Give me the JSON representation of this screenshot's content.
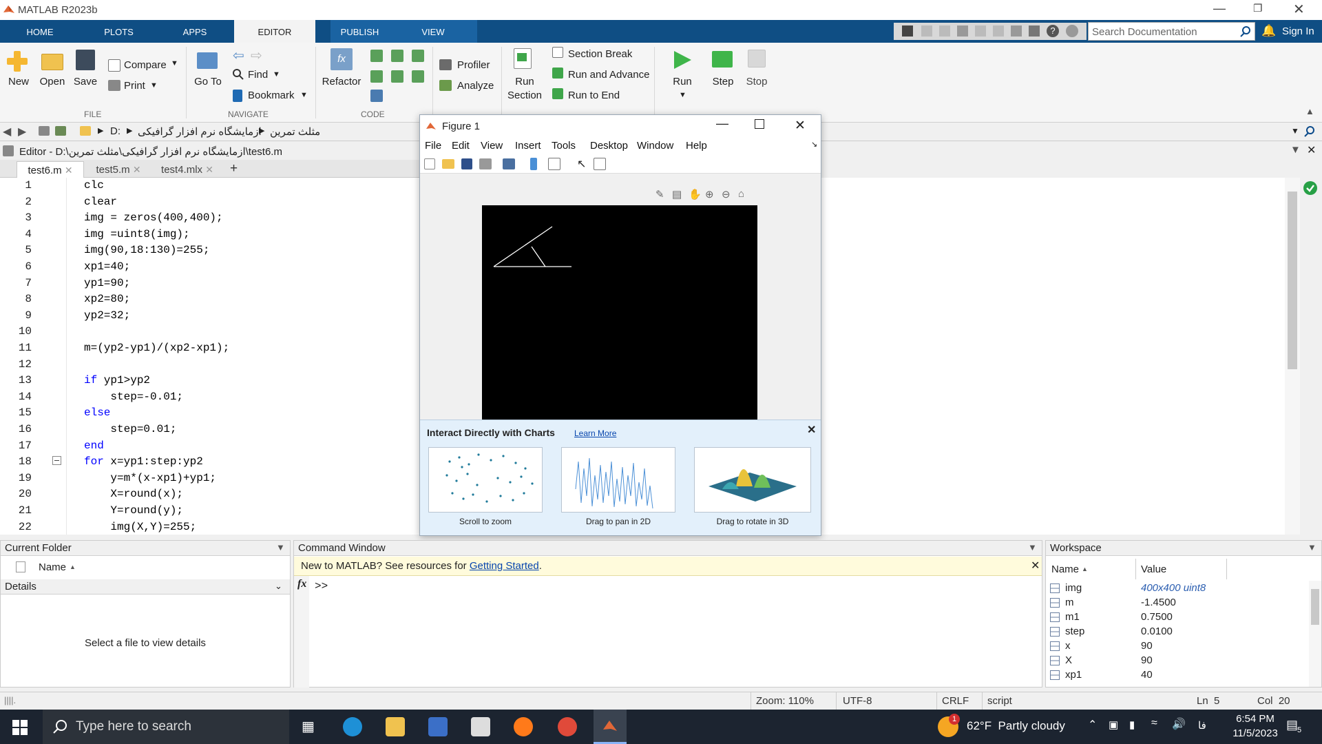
{
  "app": {
    "title": "MATLAB R2023b"
  },
  "tabs": [
    "HOME",
    "PLOTS",
    "APPS",
    "EDITOR",
    "PUBLISH",
    "VIEW"
  ],
  "active_tab": "EDITOR",
  "search": {
    "placeholder": "Search Documentation"
  },
  "sign_in": "Sign In",
  "ribbon": {
    "new": "New",
    "open": "Open",
    "save": "Save",
    "compare": "Compare",
    "print": "Print",
    "file_group": "FILE",
    "goto": "Go To",
    "find": "Find",
    "bookmark": "Bookmark",
    "navigate_group": "NAVIGATE",
    "refactor": "Refactor",
    "code_group": "CODE",
    "profiler": "Profiler",
    "analyze": "Analyze",
    "run_section": "Run",
    "run_section2": "Section",
    "section_break": "Section Break",
    "run_and_advance": "Run and Advance",
    "run_to_end": "Run to End",
    "run": "Run",
    "step": "Step",
    "stop": "Stop"
  },
  "address": {
    "drive": "D:",
    "folder1": "ازمایشگاه نرم افزار گرافیکی",
    "folder2": "مثلث تمرین"
  },
  "editor": {
    "title": "Editor - D:\\ازمایشگاه نرم افزار گرافیکی\\مثلث تمرین\\test6.m",
    "tabs": [
      "test6.m",
      "test5.m",
      "test4.mlx"
    ],
    "lines": [
      {
        "n": "1",
        "t": "clc"
      },
      {
        "n": "2",
        "t": "clear"
      },
      {
        "n": "3",
        "t": "img = zeros(400,400);"
      },
      {
        "n": "4",
        "t": "img =uint8(img);"
      },
      {
        "n": "5",
        "t": "img(90,18:130)=255;"
      },
      {
        "n": "6",
        "t": "xp1=40;"
      },
      {
        "n": "7",
        "t": "yp1=90;"
      },
      {
        "n": "8",
        "t": "xp2=80;"
      },
      {
        "n": "9",
        "t": "yp2=32;"
      },
      {
        "n": "10",
        "t": ""
      },
      {
        "n": "11",
        "t": "m=(yp2-yp1)/(xp2-xp1);"
      },
      {
        "n": "12",
        "t": ""
      },
      {
        "n": "13",
        "kw": "if",
        "t": " yp1>yp2"
      },
      {
        "n": "14",
        "t": "    step=-0.01;"
      },
      {
        "n": "15",
        "kw": "else",
        "t": ""
      },
      {
        "n": "16",
        "t": "    step=0.01;"
      },
      {
        "n": "17",
        "kw": "end",
        "t": ""
      },
      {
        "n": "18",
        "kw": "for",
        "t": " x=yp1:step:yp2"
      },
      {
        "n": "19",
        "t": "    y=m*(x-xp1)+yp1;"
      },
      {
        "n": "20",
        "t": "    X=round(x);"
      },
      {
        "n": "21",
        "t": "    Y=round(y);"
      },
      {
        "n": "22",
        "t": "    img(X,Y)=255;"
      }
    ]
  },
  "figure": {
    "title": "Figure 1",
    "menu": [
      "File",
      "Edit",
      "View",
      "Insert",
      "Tools",
      "Desktop",
      "Window",
      "Help"
    ],
    "tip_title": "Interact Directly with Charts",
    "learn_more": "Learn More",
    "cards": [
      "Scroll to zoom",
      "Drag to pan in 2D",
      "Drag to rotate in 3D"
    ]
  },
  "current_folder": {
    "title": "Current Folder",
    "col_name": "Name",
    "details": "Details",
    "empty": "Select a file to view details"
  },
  "command_window": {
    "title": "Command Window",
    "banner_prefix": "New to MATLAB? See resources for ",
    "banner_link": "Getting Started",
    "banner_suffix": ".",
    "prompt": ">>"
  },
  "workspace": {
    "title": "Workspace",
    "col_name": "Name",
    "col_value": "Value",
    "vars": [
      {
        "name": "img",
        "value": "400x400 uint8"
      },
      {
        "name": "m",
        "value": "-1.4500"
      },
      {
        "name": "m1",
        "value": "0.7500"
      },
      {
        "name": "step",
        "value": "0.0100"
      },
      {
        "name": "x",
        "value": "90"
      },
      {
        "name": "X",
        "value": "90"
      },
      {
        "name": "xp1",
        "value": "40"
      }
    ]
  },
  "status": {
    "zoom": "Zoom: 110%",
    "encoding": "UTF-8",
    "eol": "CRLF",
    "type": "script",
    "ln": "Ln  5",
    "col": "Col  20"
  },
  "taskbar": {
    "search": "Type here to search",
    "weather": "62°F  Partly cloudy",
    "time": "6:54 PM",
    "date": "11/5/2023",
    "lang": "فا",
    "notif": "5",
    "weather_badge": "1"
  },
  "colors": {
    "tabbar": "#0f4e84",
    "taskbar": "#1c2430",
    "accent": "#0072bd"
  }
}
